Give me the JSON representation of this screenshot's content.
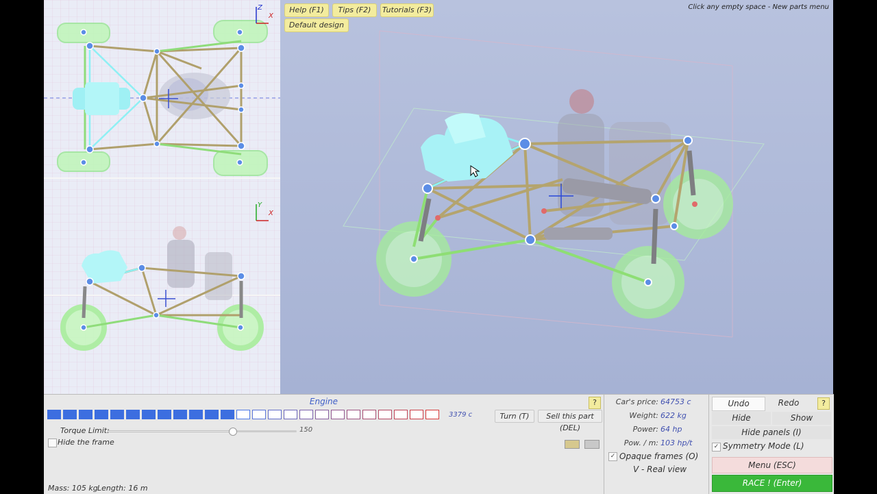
{
  "toolbar": {
    "help": "Help (F1)",
    "tips": "Tips (F2)",
    "tutorials": "Tutorials (F3)",
    "default_design": "Default design"
  },
  "hint": "Click any empty space - New parts menu",
  "axes": {
    "top": {
      "vertical": "Z",
      "horizontal": "X"
    },
    "side": {
      "vertical": "Y",
      "horizontal": "X"
    }
  },
  "engine_panel": {
    "title": "Engine",
    "help": "?",
    "price": "3379 c",
    "turn_label": "Turn (T)",
    "sell_label": "Sell this part (DEL)",
    "torque_label": "Torque Limit:",
    "torque_max": "150",
    "torque_fraction": 0.66,
    "hide_frame_label": "Hide the frame",
    "hide_frame_checked": false,
    "mass_label": "Mass: 105 kg",
    "length_label": "Length: 16 m",
    "bars_total": 25,
    "bars_filled": 12,
    "colors": {
      "filled": "#3c6ee0",
      "empty": "#4c78e6",
      "red": "#d83a3a",
      "accent": "#4050b0"
    },
    "swatches": [
      "#d6c88e",
      "#c8c8c8"
    ]
  },
  "stats": {
    "price": {
      "label": "Car's price:",
      "value": "64753 c"
    },
    "weight": {
      "label": "Weight:",
      "value": "622 kg"
    },
    "power": {
      "label": "Power:",
      "value": "64 hp"
    },
    "pow_mass": {
      "label": "Pow. / m:",
      "value": "103 hp/t"
    },
    "opaque": {
      "label": "Opaque frames (O)",
      "checked": true
    },
    "real_view": "V - Real view"
  },
  "controls": {
    "undo": "Undo",
    "redo": "Redo",
    "help": "?",
    "hide": "Hide",
    "show": "Show",
    "hide_panels": "Hide panels (I)",
    "symmetry": {
      "label": "Symmetry Mode (L)",
      "checked": true
    },
    "menu": "Menu (ESC)",
    "race": "RACE ! (Enter)"
  },
  "icons": [
    "cursor-hand-icon",
    "checkbox-icon",
    "help-icon"
  ]
}
